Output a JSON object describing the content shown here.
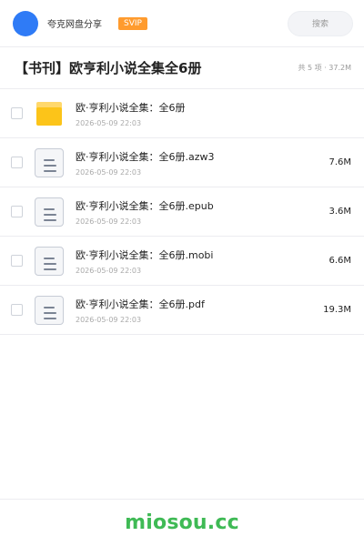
{
  "header": {
    "username": "夸克网盘分享",
    "badge": "SVIP",
    "search_placeholder": "搜索",
    "avatar_color": "#2f7bf6",
    "badge_color": "#ff9b2e"
  },
  "folder": {
    "title": "【书刊】欧亨利小说全集全6册",
    "summary": "共 5 项 · 37.2M"
  },
  "files": [
    {
      "name": "欧·亨利小说全集：全6册",
      "date": "2026-05-09 22:03",
      "size": "",
      "icon": "folder-icon"
    },
    {
      "name": "欧·亨利小说全集：全6册.azw3",
      "date": "2026-05-09 22:03",
      "size": "7.6M",
      "icon": "document-icon"
    },
    {
      "name": "欧·亨利小说全集：全6册.epub",
      "date": "2026-05-09 22:03",
      "size": "3.6M",
      "icon": "document-icon"
    },
    {
      "name": "欧·亨利小说全集：全6册.mobi",
      "date": "2026-05-09 22:03",
      "size": "6.6M",
      "icon": "document-icon"
    },
    {
      "name": "欧·亨利小说全集：全6册.pdf",
      "date": "2026-05-09 22:03",
      "size": "19.3M",
      "icon": "document-icon"
    }
  ],
  "footer": {
    "brand": "miosou.cc",
    "brand_color": "#3fba55"
  }
}
